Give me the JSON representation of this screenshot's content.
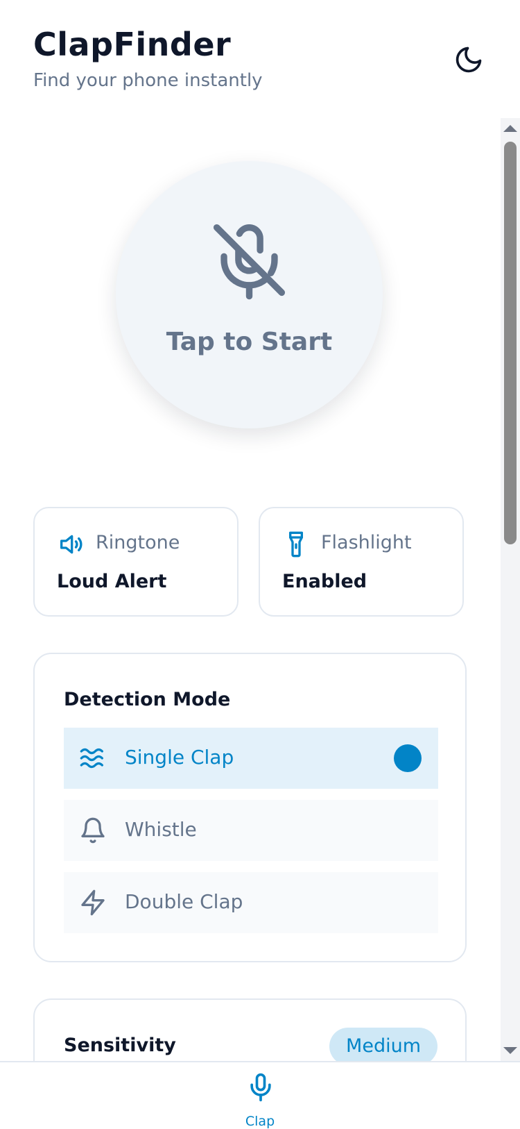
{
  "header": {
    "title": "ClapFinder",
    "subtitle": "Find your phone instantly",
    "theme_icon": "moon-icon"
  },
  "start": {
    "label": "Tap to Start",
    "icon": "mic-off-icon"
  },
  "info_cards": [
    {
      "label": "Ringtone",
      "value": "Loud Alert",
      "icon": "speaker-icon"
    },
    {
      "label": "Flashlight",
      "value": "Enabled",
      "icon": "flashlight-icon"
    }
  ],
  "detection": {
    "title": "Detection Mode",
    "options": [
      {
        "label": "Single Clap",
        "icon": "waves-icon",
        "selected": true
      },
      {
        "label": "Whistle",
        "icon": "bell-icon",
        "selected": false
      },
      {
        "label": "Double Clap",
        "icon": "lightning-icon",
        "selected": false
      }
    ]
  },
  "sensitivity": {
    "title": "Sensitivity",
    "value": "Medium"
  },
  "nav": {
    "items": [
      {
        "label": "Clap",
        "icon": "mic-icon",
        "active": true
      }
    ]
  },
  "colors": {
    "accent": "#0284c7",
    "accent_light": "#e3f1fa",
    "muted_text": "#64748b",
    "primary_text": "#0f172a",
    "border": "#e2e8f0"
  }
}
